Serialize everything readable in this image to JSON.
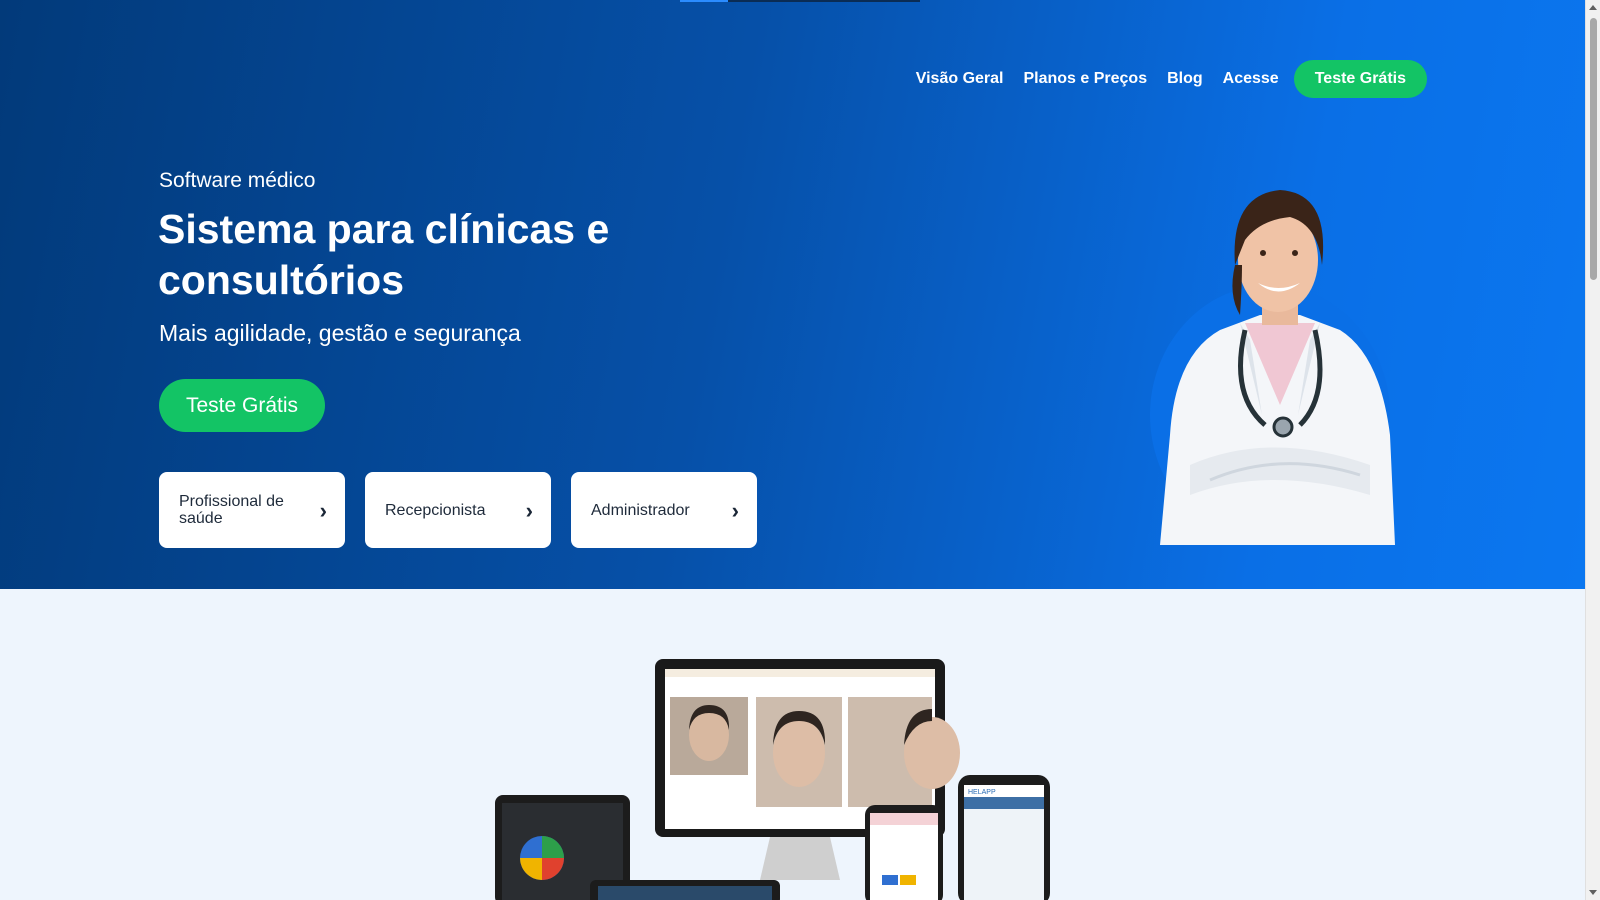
{
  "nav": {
    "items": [
      {
        "label": "Visão Geral"
      },
      {
        "label": "Planos e Preços"
      },
      {
        "label": "Blog"
      },
      {
        "label": "Acesse"
      }
    ],
    "cta_label": "Teste Grátis"
  },
  "hero": {
    "eyebrow": "Software médico",
    "headline": "Sistema para clínicas e consultórios",
    "subtitle": "Mais agilidade, gestão e segurança",
    "cta_label": "Teste Grátis",
    "roles": [
      {
        "label": "Profissional de saúde"
      },
      {
        "label": "Recepcionista"
      },
      {
        "label": "Administrador"
      }
    ]
  },
  "colors": {
    "hero_gradient_start": "#023a7a",
    "hero_gradient_end": "#0b77f0",
    "cta_green": "#13c465",
    "lower_bg": "#eef5fd"
  },
  "icons": {
    "role_arrow": "chevron-right-icon"
  },
  "mockup": {
    "phone_brand": "HELAPP"
  }
}
